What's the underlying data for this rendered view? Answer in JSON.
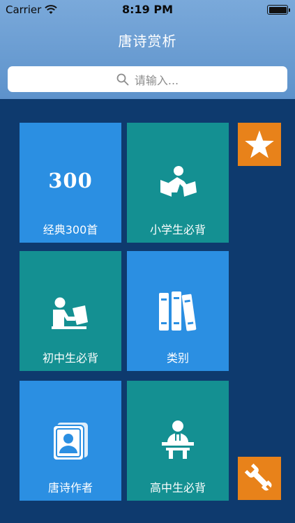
{
  "status": {
    "carrier": "Carrier",
    "time": "8:19 PM"
  },
  "nav": {
    "title": "唐诗赏析"
  },
  "search": {
    "placeholder": "请输入..."
  },
  "tiles": [
    {
      "label": "经典300首",
      "color": "#2b8fe2",
      "icon": "300-number-icon",
      "icon_text": "300"
    },
    {
      "label": "小学生必背",
      "color": "#149092",
      "icon": "child-reading-icon"
    },
    {
      "label": "初中生必背",
      "color": "#149092",
      "icon": "student-reading-icon"
    },
    {
      "label": "类别",
      "color": "#2b8fe2",
      "icon": "books-icon"
    },
    {
      "label": "唐诗作者",
      "color": "#2b8fe2",
      "icon": "author-card-icon"
    },
    {
      "label": "高中生必背",
      "color": "#149092",
      "icon": "lecturer-podium-icon"
    }
  ],
  "side_buttons": [
    {
      "icon": "star-icon",
      "color": "#e8821a"
    },
    {
      "icon": "wrench-icon",
      "color": "#e8821a"
    }
  ]
}
